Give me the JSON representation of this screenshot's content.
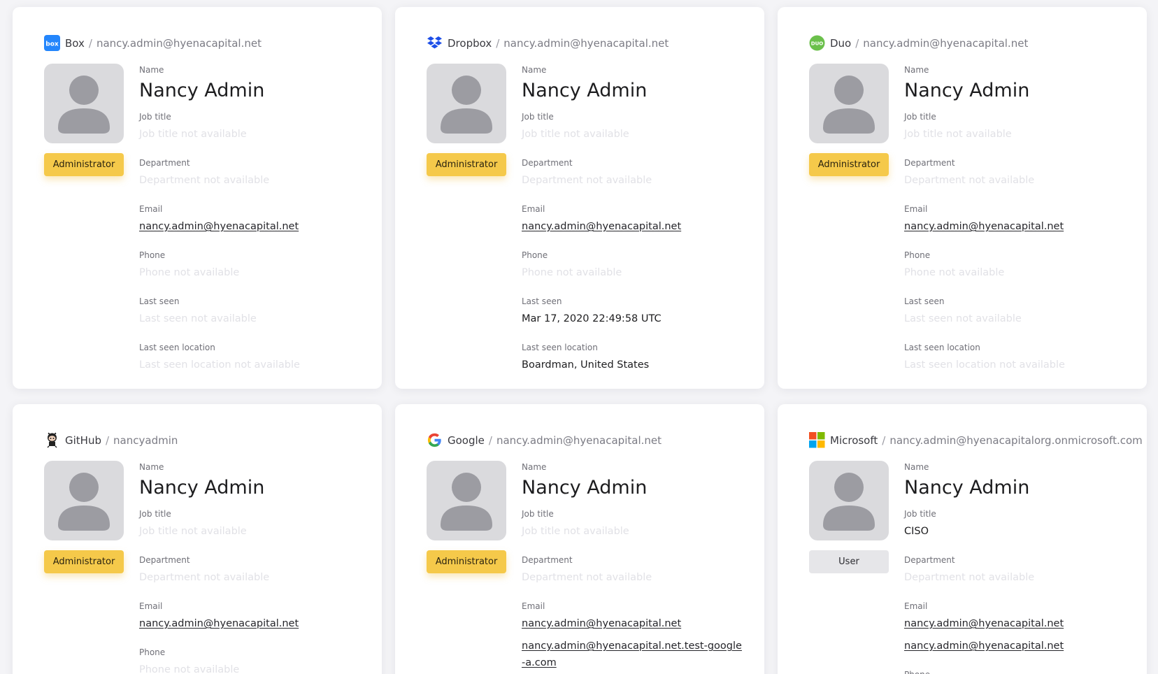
{
  "labels": {
    "name": "Name",
    "job_title": "Job title",
    "department": "Department",
    "email": "Email",
    "phone": "Phone",
    "last_seen": "Last seen",
    "last_seen_location": "Last seen location"
  },
  "separator": "/",
  "cards": [
    {
      "service": "Box",
      "icon": "box-icon",
      "account": "nancy.admin@hyenacapital.net",
      "name": "Nancy Admin",
      "role": "Administrator",
      "job_title": "Job title not available",
      "department": "Department not available",
      "emails": [
        "nancy.admin@hyenacapital.net"
      ],
      "phone": "Phone not available",
      "last_seen": "Last seen not available",
      "last_seen_location": "Last seen location not available"
    },
    {
      "service": "Dropbox",
      "icon": "dropbox-icon",
      "account": "nancy.admin@hyenacapital.net",
      "name": "Nancy Admin",
      "role": "Administrator",
      "job_title": "Job title not available",
      "department": "Department not available",
      "emails": [
        "nancy.admin@hyenacapital.net"
      ],
      "phone": "Phone not available",
      "last_seen": "Mar 17, 2020 22:49:58 UTC",
      "last_seen_location": "Boardman, United States"
    },
    {
      "service": "Duo",
      "icon": "duo-icon",
      "account": "nancy.admin@hyenacapital.net",
      "name": "Nancy Admin",
      "role": "Administrator",
      "job_title": "Job title not available",
      "department": "Department not available",
      "emails": [
        "nancy.admin@hyenacapital.net"
      ],
      "phone": "Phone not available",
      "last_seen": "Last seen not available",
      "last_seen_location": "Last seen location not available"
    },
    {
      "service": "GitHub",
      "icon": "github-octocat-icon",
      "account": "nancyadmin",
      "name": "Nancy Admin",
      "role": "Administrator",
      "job_title": "Job title not available",
      "department": "Department not available",
      "emails": [
        "nancy.admin@hyenacapital.net"
      ],
      "phone": "Phone not available"
    },
    {
      "service": "Google",
      "icon": "google-icon",
      "account": "nancy.admin@hyenacapital.net",
      "name": "Nancy Admin",
      "role": "Administrator",
      "job_title": "Job title not available",
      "department": "Department not available",
      "emails": [
        "nancy.admin@hyenacapital.net",
        "nancy.admin@hyenacapital.net.test-google-a.com"
      ]
    },
    {
      "service": "Microsoft",
      "icon": "microsoft-icon",
      "account": "nancy.admin@hyenacapitalorg.onmicrosoft.com",
      "name": "Nancy Admin",
      "role": "User",
      "job_title": "CISO",
      "department": "Department not available",
      "emails": [
        "nancy.admin@hyenacapital.net",
        "nancy.admin@hyenacapital.net"
      ],
      "phone_label_only": true
    }
  ],
  "colors": {
    "admin_badge": "#f5c94a",
    "user_badge": "#e6e6e9",
    "unavailable_text": "#e1e1e6",
    "page_background": "#f4f4f7"
  }
}
